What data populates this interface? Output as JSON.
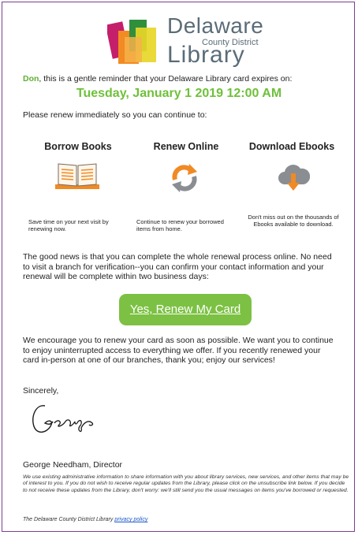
{
  "logo": {
    "line1": "Delaware",
    "line2": "County District",
    "line3": "Library"
  },
  "greeting": {
    "name": "Don",
    "rest": ", this is a gentle reminder that your Delaware Library card expires on:"
  },
  "expiry_date": "Tuesday, January 1 2019 12:00 AM",
  "renew_intro": "Please renew immediately so you can continue to:",
  "features": [
    {
      "title": "Borrow Books",
      "icon": "open-book-icon",
      "text": "Save time on your next visit by renewing now."
    },
    {
      "title": "Renew Online",
      "icon": "refresh-arrows-icon",
      "text": "Continue to renew your borrowed items from home."
    },
    {
      "title": "Download Ebooks",
      "icon": "cloud-download-icon",
      "text": "Don't miss out on the thousands of Ebooks available to download."
    }
  ],
  "good_news": "The good news is that you can complete the whole renewal process online. No need to visit a branch for verification--you can confirm your contact information and your renewal will be complete within two business days:",
  "renew_button": "Yes, Renew My Card",
  "encourage": "We encourage you to renew your card as soon as possible. We want you to continue to enjoy uninterrupted access to everything we offer.  If you recently renewed your card in-person at one of our branches, thank you; enjoy our services!",
  "sincerely": "Sincerely,",
  "signature": "George",
  "signer": "George Needham, Director",
  "legal": "We use existing administrative information to share information with you about library services, new services, and other items that may be of interest to you. If you do not wish to receive regular updates from the Library, please click on the unsubscribe link below. If you decide to not receive these updates from the Library, don't worry: we'll still send you the usual messages on items you've borrowed or requested.",
  "footer": {
    "text": "The Delaware County District Library",
    "link": "privacy policy"
  },
  "colors": {
    "accent_green": "#6fc03b",
    "button_green": "#7cc143",
    "logo_text": "#5a6c78",
    "frame": "#7a3e93",
    "orange": "#f08a24",
    "link_blue": "#1a56c8"
  }
}
